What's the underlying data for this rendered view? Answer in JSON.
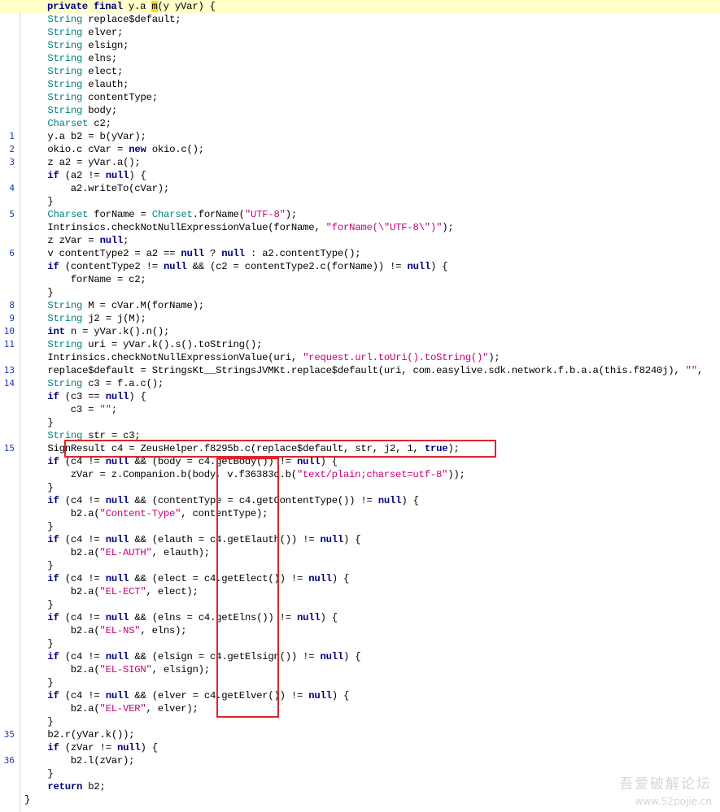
{
  "code_lines": [
    {
      "ln": "",
      "t": "private final y.a m(y yVar) {"
    },
    {
      "ln": "",
      "t": "    String replace$default;"
    },
    {
      "ln": "",
      "t": "    String elver;"
    },
    {
      "ln": "",
      "t": "    String elsign;"
    },
    {
      "ln": "",
      "t": "    String elns;"
    },
    {
      "ln": "",
      "t": "    String elect;"
    },
    {
      "ln": "",
      "t": "    String elauth;"
    },
    {
      "ln": "",
      "t": "    String contentType;"
    },
    {
      "ln": "",
      "t": "    String body;"
    },
    {
      "ln": "",
      "t": "    Charset c2;"
    },
    {
      "ln": "1",
      "t": "    y.a b2 = b(yVar);"
    },
    {
      "ln": "2",
      "t": "    okio.c cVar = new okio.c();"
    },
    {
      "ln": "3",
      "t": "    z a2 = yVar.a();"
    },
    {
      "ln": "",
      "t": "    if (a2 != null) {"
    },
    {
      "ln": "4",
      "t": "        a2.writeTo(cVar);"
    },
    {
      "ln": "",
      "t": "    }"
    },
    {
      "ln": "5",
      "t": "    Charset forName = Charset.forName(\"UTF-8\");"
    },
    {
      "ln": "",
      "t": "    Intrinsics.checkNotNullExpressionValue(forName, \"forName(\\\"UTF-8\\\")\");"
    },
    {
      "ln": "",
      "t": "    z zVar = null;"
    },
    {
      "ln": "6",
      "t": "    v contentType2 = a2 == null ? null : a2.contentType();"
    },
    {
      "ln": "",
      "t": "    if (contentType2 != null && (c2 = contentType2.c(forName)) != null) {"
    },
    {
      "ln": "",
      "t": "        forName = c2;"
    },
    {
      "ln": "",
      "t": "    }"
    },
    {
      "ln": "8",
      "t": "    String M = cVar.M(forName);"
    },
    {
      "ln": "9",
      "t": "    String j2 = j(M);"
    },
    {
      "ln": "10",
      "t": "    int n = yVar.k().n();"
    },
    {
      "ln": "11",
      "t": "    String uri = yVar.k().s().toString();"
    },
    {
      "ln": "",
      "t": "    Intrinsics.checkNotNullExpressionValue(uri, \"request.url.toUri().toString()\");"
    },
    {
      "ln": "13",
      "t": "    replace$default = StringsKt__StringsJVMKt.replace$default(uri, com.easylive.sdk.network.f.b.a.a(this.f8240j), \"\","
    },
    {
      "ln": "14",
      "t": "    String c3 = f.a.c();"
    },
    {
      "ln": "",
      "t": "    if (c3 == null) {"
    },
    {
      "ln": "",
      "t": "        c3 = \"\";"
    },
    {
      "ln": "",
      "t": "    }"
    },
    {
      "ln": "",
      "t": "    String str = c3;"
    },
    {
      "ln": "15",
      "t": "    SignResult c4 = ZeusHelper.f8295b.c(replace$default, str, j2, 1, true);"
    },
    {
      "ln": "",
      "t": "    if (c4 != null && (body = c4.getBody()) != null) {"
    },
    {
      "ln": "",
      "t": "        zVar = z.Companion.b(body, v.f36383c.b(\"text/plain;charset=utf-8\"));"
    },
    {
      "ln": "",
      "t": "    }"
    },
    {
      "ln": "",
      "t": "    if (c4 != null && (contentType = c4.getContentType()) != null) {"
    },
    {
      "ln": "",
      "t": "        b2.a(\"Content-Type\", contentType);"
    },
    {
      "ln": "",
      "t": "    }"
    },
    {
      "ln": "",
      "t": "    if (c4 != null && (elauth = c4.getElauth()) != null) {"
    },
    {
      "ln": "",
      "t": "        b2.a(\"EL-AUTH\", elauth);"
    },
    {
      "ln": "",
      "t": "    }"
    },
    {
      "ln": "",
      "t": "    if (c4 != null && (elect = c4.getElect()) != null) {"
    },
    {
      "ln": "",
      "t": "        b2.a(\"EL-ECT\", elect);"
    },
    {
      "ln": "",
      "t": "    }"
    },
    {
      "ln": "",
      "t": "    if (c4 != null && (elns = c4.getElns()) != null) {"
    },
    {
      "ln": "",
      "t": "        b2.a(\"EL-NS\", elns);"
    },
    {
      "ln": "",
      "t": "    }"
    },
    {
      "ln": "",
      "t": "    if (c4 != null && (elsign = c4.getElsign()) != null) {"
    },
    {
      "ln": "",
      "t": "        b2.a(\"EL-SIGN\", elsign);"
    },
    {
      "ln": "",
      "t": "    }"
    },
    {
      "ln": "",
      "t": "    if (c4 != null && (elver = c4.getElver()) != null) {"
    },
    {
      "ln": "",
      "t": "        b2.a(\"EL-VER\", elver);"
    },
    {
      "ln": "",
      "t": "    }"
    },
    {
      "ln": "35",
      "t": "    b2.r(yVar.k());"
    },
    {
      "ln": "",
      "t": "    if (zVar != null) {"
    },
    {
      "ln": "36",
      "t": "        b2.l(zVar);"
    },
    {
      "ln": "",
      "t": "    }"
    },
    {
      "ln": "",
      "t": "    return b2;"
    },
    {
      "ln": "",
      "t": "}"
    }
  ],
  "watermark": {
    "line1": "吾爱破解论坛",
    "line2": "www.52pojie.cn"
  },
  "colors": {
    "keyword": "#000080",
    "type": "#008080",
    "string": "#c8007a",
    "line_number": "#1c39b8",
    "annotation_box": "#e0242c",
    "current_line": "#ffffc8"
  }
}
